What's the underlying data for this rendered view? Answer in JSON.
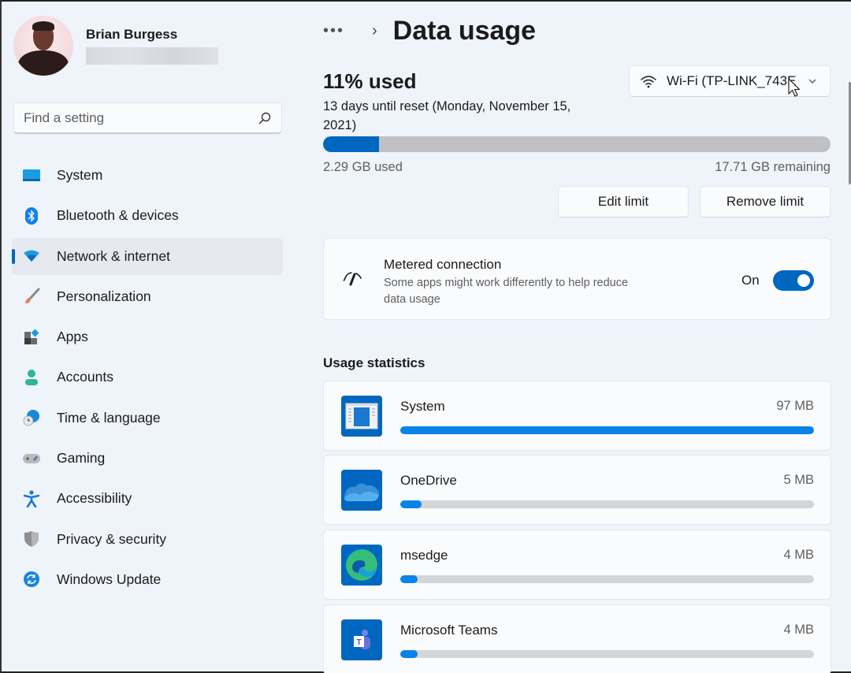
{
  "profile": {
    "name": "Brian Burgess"
  },
  "search": {
    "placeholder": "Find a setting"
  },
  "sidebar": {
    "items": [
      {
        "label": "System",
        "icon": "system-icon",
        "active": false
      },
      {
        "label": "Bluetooth & devices",
        "icon": "bluetooth-icon",
        "active": false
      },
      {
        "label": "Network & internet",
        "icon": "wifi-icon",
        "active": true
      },
      {
        "label": "Personalization",
        "icon": "paintbrush-icon",
        "active": false
      },
      {
        "label": "Apps",
        "icon": "apps-icon",
        "active": false
      },
      {
        "label": "Accounts",
        "icon": "person-icon",
        "active": false
      },
      {
        "label": "Time & language",
        "icon": "globe-clock-icon",
        "active": false
      },
      {
        "label": "Gaming",
        "icon": "gamepad-icon",
        "active": false
      },
      {
        "label": "Accessibility",
        "icon": "accessibility-icon",
        "active": false
      },
      {
        "label": "Privacy & security",
        "icon": "shield-icon",
        "active": false
      },
      {
        "label": "Windows Update",
        "icon": "update-icon",
        "active": false
      }
    ]
  },
  "header": {
    "breadcrumb_more": "•••",
    "breadcrumb_sep": "›",
    "title": "Data usage"
  },
  "usage": {
    "percent_label": "11% used",
    "percent_used": 11,
    "reset_text": "13 days until reset (Monday, November 15, 2021)",
    "used_label": "2.29 GB used",
    "remaining_label": "17.71 GB remaining"
  },
  "network_select": {
    "selected": "Wi-Fi (TP-LINK_743E)"
  },
  "buttons": {
    "edit_limit": "Edit limit",
    "remove_limit": "Remove limit"
  },
  "metered": {
    "title": "Metered connection",
    "description": "Some apps might work differently to help reduce data usage",
    "toggle_label": "On",
    "toggle_on": true
  },
  "usage_statistics": {
    "title": "Usage statistics",
    "apps": [
      {
        "name": "System",
        "size": "97 MB",
        "fraction": 1.0,
        "icon": "system-app-icon"
      },
      {
        "name": "OneDrive",
        "size": "5 MB",
        "fraction": 0.052,
        "icon": "onedrive-icon"
      },
      {
        "name": "msedge",
        "size": "4 MB",
        "fraction": 0.041,
        "icon": "edge-icon"
      },
      {
        "name": "Microsoft Teams",
        "size": "4 MB",
        "fraction": 0.041,
        "icon": "teams-icon"
      }
    ]
  },
  "colors": {
    "accent": "#0067c0",
    "app_bar_accent": "#0a83e8",
    "background": "#eff3fa"
  }
}
